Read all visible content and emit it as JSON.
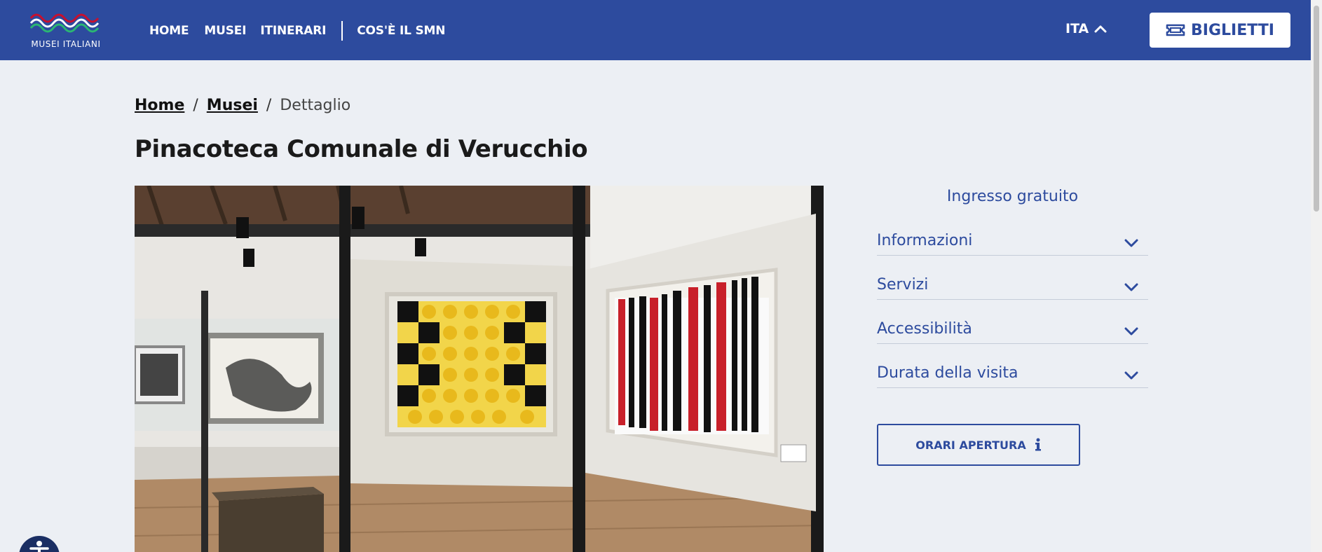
{
  "header": {
    "logo_text": "MUSEI ITALIANI",
    "nav": [
      "HOME",
      "MUSEI",
      "ITINERARI",
      "COS'È IL SMN"
    ],
    "language": "ITA",
    "tickets_label": "BIGLIETTI"
  },
  "breadcrumb": {
    "home": "Home",
    "musei": "Musei",
    "separator": "/",
    "current": "Dettaglio"
  },
  "page": {
    "title": "Pinacoteca Comunale di Verucchio"
  },
  "sidebar": {
    "entry_label": "Ingresso gratuito",
    "sections": [
      "Informazioni",
      "Servizi",
      "Accessibilità",
      "Durata della visita"
    ],
    "hours_button": "ORARI APERTURA"
  },
  "colors": {
    "brand_blue": "#2d4b9e",
    "background": "#eceff4",
    "text_dark": "#1a1a1a"
  },
  "icons": [
    "logo-waves-icon",
    "chevron-up-icon",
    "ticket-icon",
    "chevron-down-icon",
    "info-icon",
    "accessibility-icon"
  ]
}
